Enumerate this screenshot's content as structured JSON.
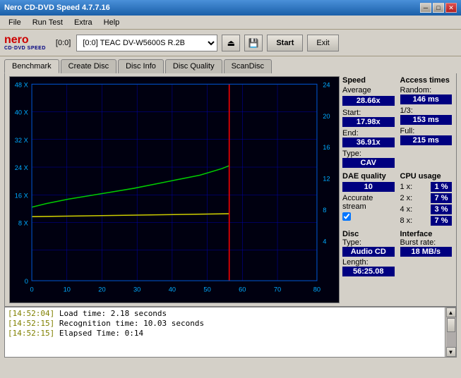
{
  "window": {
    "title": "Nero CD-DVD Speed 4.7.7.16",
    "controls": {
      "minimize": "─",
      "maximize": "□",
      "close": "✕"
    }
  },
  "menu": {
    "items": [
      "File",
      "Run Test",
      "Extra",
      "Help"
    ]
  },
  "toolbar": {
    "logo": {
      "nero": "nero",
      "sub": "CD·DVD SPEED"
    },
    "drive_label": "[0:0]",
    "drive_name": "TEAC DV-W5600S R.2B",
    "start_label": "Start",
    "exit_label": "Exit"
  },
  "tabs": [
    {
      "label": "Benchmark",
      "active": true
    },
    {
      "label": "Create Disc"
    },
    {
      "label": "Disc Info"
    },
    {
      "label": "Disc Quality"
    },
    {
      "label": "ScanDisc"
    }
  ],
  "chart": {
    "y_left_labels": [
      "48 X",
      "40 X",
      "32 X",
      "24 X",
      "16 X",
      "8 X",
      "0"
    ],
    "y_right_labels": [
      "24",
      "20",
      "16",
      "12",
      "8",
      "4"
    ],
    "x_labels": [
      "0",
      "10",
      "20",
      "30",
      "40",
      "50",
      "60",
      "70",
      "80"
    ]
  },
  "stats": {
    "speed": {
      "title": "Speed",
      "average_label": "Average",
      "average_value": "28.66x",
      "start_label": "Start:",
      "start_value": "17.98x",
      "end_label": "End:",
      "end_value": "36.91x",
      "type_label": "Type:",
      "type_value": "CAV"
    },
    "dae": {
      "title": "DAE quality",
      "value": "10",
      "accurate_label": "Accurate stream"
    },
    "access": {
      "title": "Access times",
      "random_label": "Random:",
      "random_value": "146 ms",
      "third_label": "1/3:",
      "third_value": "153 ms",
      "full_label": "Full:",
      "full_value": "215 ms"
    },
    "cpu": {
      "title": "CPU usage",
      "items": [
        {
          "label": "1 x:",
          "value": "1 %"
        },
        {
          "label": "2 x:",
          "value": "7 %"
        },
        {
          "label": "4 x:",
          "value": "3 %"
        },
        {
          "label": "8 x:",
          "value": "7 %"
        }
      ]
    },
    "disc": {
      "title": "Disc",
      "type_label": "Type:",
      "type_value": "Audio CD",
      "length_label": "Length:",
      "length_value": "56:25.08"
    },
    "interface": {
      "title": "Interface",
      "burst_label": "Burst rate:",
      "burst_value": "18 MB/s"
    }
  },
  "log": {
    "lines": [
      {
        "timestamp": "[14:52:04]",
        "text": "Load time: 2.18 seconds"
      },
      {
        "timestamp": "[14:52:15]",
        "text": "Recognition time: 10.03 seconds"
      },
      {
        "timestamp": "[14:52:15]",
        "text": "Elapsed Time: 0:14"
      }
    ]
  }
}
